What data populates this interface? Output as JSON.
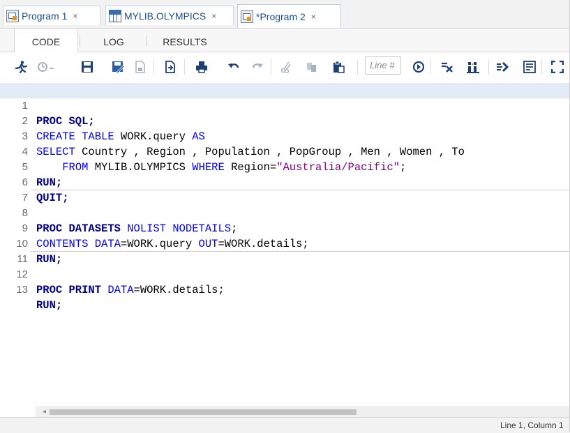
{
  "doc_tabs": [
    {
      "title": "Program 1",
      "close": "×",
      "icon": "program-icon",
      "active": false
    },
    {
      "title": "MYLIB.OLYMPICS",
      "close": "×",
      "icon": "table-icon",
      "active": false
    },
    {
      "title": "*Program 2",
      "close": "×",
      "icon": "program-icon",
      "active": true
    }
  ],
  "sub_tabs": {
    "code": "CODE",
    "log": "LOG",
    "results": "RESULTS",
    "active": "CODE"
  },
  "toolbar": {
    "icons": [
      "run-icon",
      "history-icon",
      "save-icon",
      "save-as-icon",
      "new-icon",
      "import-icon",
      "print-icon",
      "undo-icon",
      "redo-icon",
      "cut-icon",
      "copy-icon",
      "paste-icon",
      "goto-line-icon",
      "clear-icon",
      "format-icon",
      "snippet-icon",
      "collapse-icon",
      "maximize-icon"
    ],
    "line_placeholder": "Line #"
  },
  "editor": {
    "lines": [
      {
        "n": "1",
        "current": true
      },
      {
        "n": "2"
      },
      {
        "n": "3"
      },
      {
        "n": "4"
      },
      {
        "n": "5"
      },
      {
        "n": "6"
      },
      {
        "n": "7",
        "divider": true
      },
      {
        "n": "8"
      },
      {
        "n": "9"
      },
      {
        "n": "10"
      },
      {
        "n": "11",
        "divider": true
      },
      {
        "n": "12"
      },
      {
        "n": "13"
      }
    ],
    "tokens": {
      "l1_kw": "PROC SQL;",
      "l2_kw": "CREATE TABLE",
      "l2_txt": " WORK.query ",
      "l2_kw2": "AS",
      "l3_kw": "SELECT",
      "l3_txt": " Country , Region , Population , PopGroup , Men , Women , To",
      "l4_kw": "FROM",
      "l4_txt": " MYLIB.OLYMPICS ",
      "l4_kw2": "WHERE",
      "l4_txt2": " Region=",
      "l4_str": "\"Australia/Pacific\"",
      "l4_end": ";",
      "l5_kw": "RUN;",
      "l6_kw": "QUIT;",
      "l8_kw": "PROC DATASETS",
      "l8_kw2": " NOLIST NODETAILS",
      "l8_end": ";",
      "l9_kw": "CONTENTS DATA",
      "l9_txt": "=WORK.query ",
      "l9_kw2": "OUT",
      "l9_txt2": "=WORK.details;",
      "l10_kw": "RUN;",
      "l12_kw": "PROC PRINT",
      "l12_kw2": " DATA",
      "l12_txt": "=WORK.details;",
      "l13_kw": "RUN;"
    }
  },
  "status": {
    "position": "Line 1, Column 1"
  }
}
